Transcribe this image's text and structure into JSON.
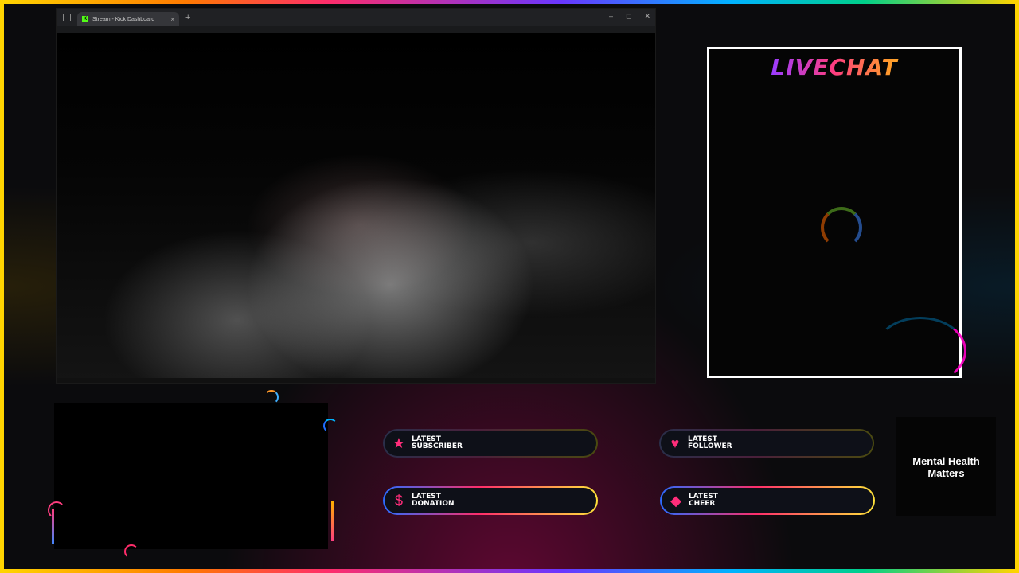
{
  "browser": {
    "tab_title": "Stream - Kick Dashboard",
    "tab_favicon": "K",
    "new_tab": "+",
    "close_tab": "×",
    "window_controls": {
      "minimize": "–",
      "restore": "◻",
      "close": "✕"
    }
  },
  "chat": {
    "title": "LIVECHAT"
  },
  "alerts": {
    "subscriber": {
      "label_line1": "LATEST",
      "label_line2": "SUBSCRIBER",
      "icon": "star-icon"
    },
    "follower": {
      "label_line1": "LATEST",
      "label_line2": "FOLLOWER",
      "icon": "heart-icon"
    },
    "donation": {
      "label_line1": "LATEST",
      "label_line2": "DONATION",
      "icon": "dollar-icon"
    },
    "cheer": {
      "label_line1": "LATEST",
      "label_line2": "CHEER",
      "icon": "diamond-icon"
    }
  },
  "card": {
    "line1": "Mental Health",
    "line2": "Matters"
  },
  "colors": {
    "accent_pink": "#ff2d7a",
    "frame_gradient": [
      "#ffd400",
      "#ff2d6a",
      "#6a36ff",
      "#00b3ff"
    ]
  }
}
